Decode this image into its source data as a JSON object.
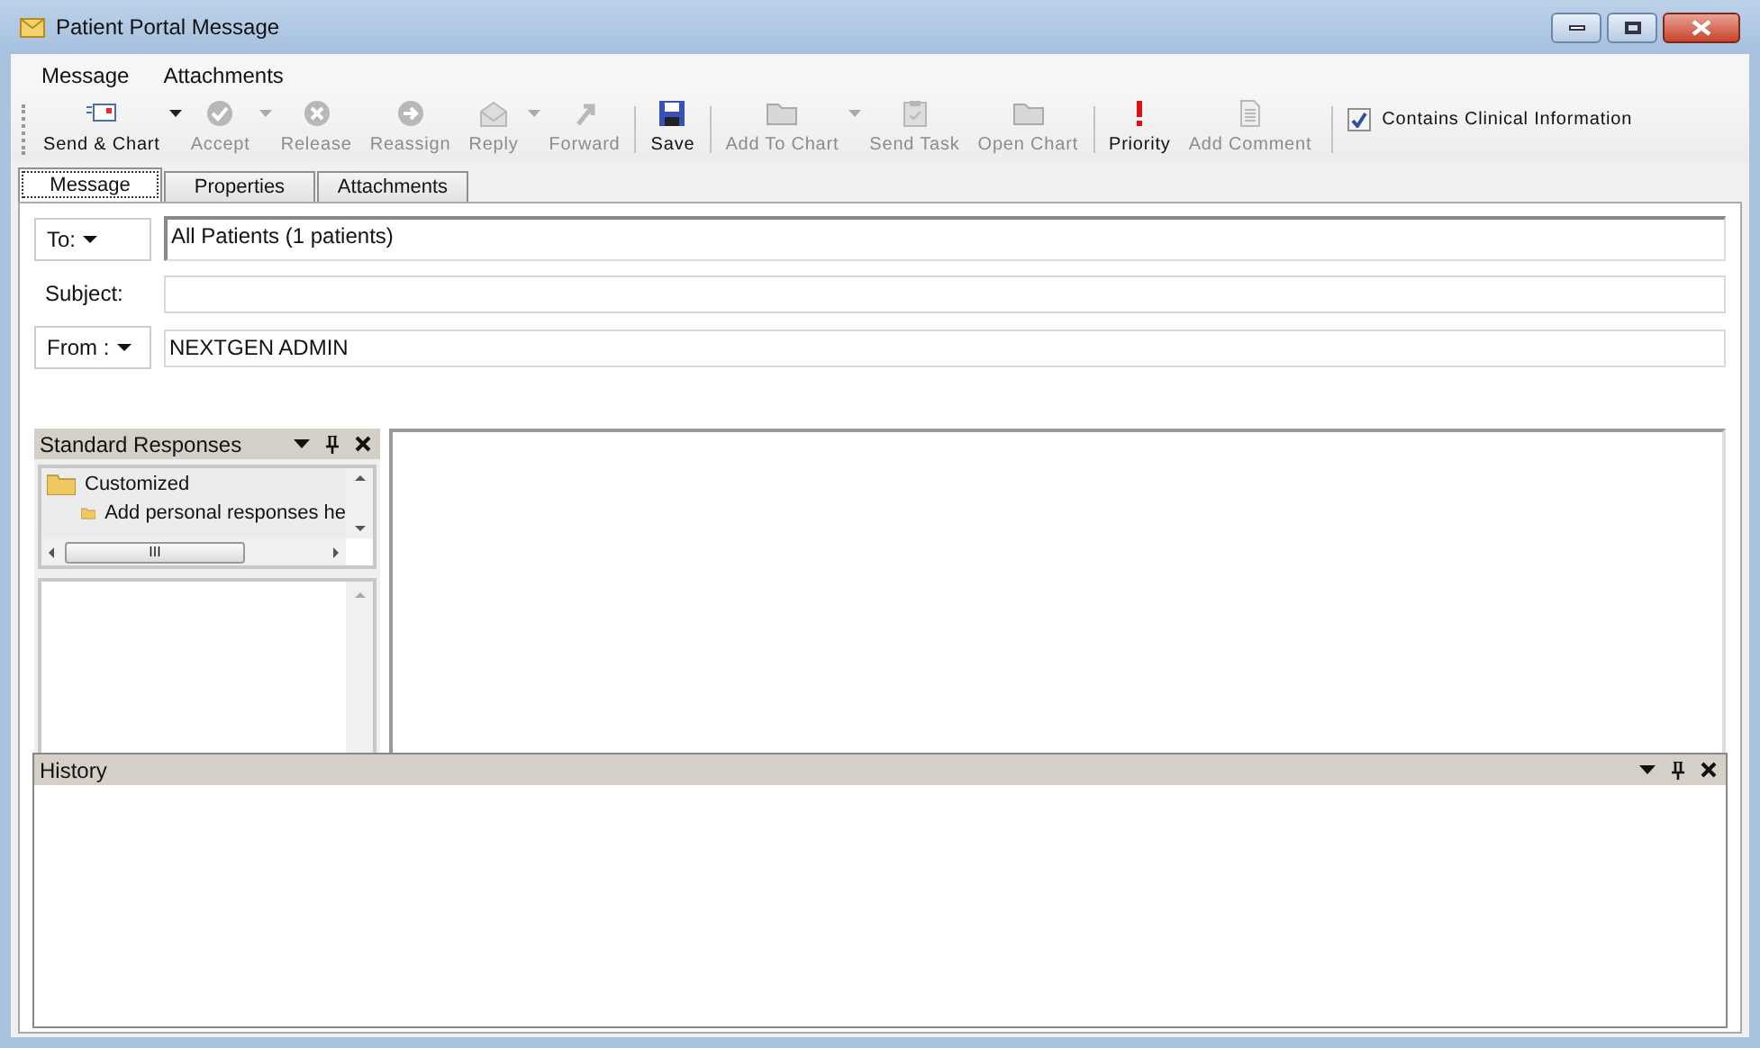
{
  "window": {
    "title": "Patient Portal Message"
  },
  "menu": [
    "Message",
    "Attachments"
  ],
  "toolbar": [
    {
      "label": "Send & Chart",
      "kind": "send",
      "disabled": false,
      "dropdown": true,
      "separator_before": false
    },
    {
      "label": "Accept",
      "kind": "check",
      "disabled": true,
      "dropdown": true,
      "separator_before": false
    },
    {
      "label": "Release",
      "kind": "x",
      "disabled": true,
      "dropdown": false,
      "separator_before": false
    },
    {
      "label": "Reassign",
      "kind": "arrow",
      "disabled": true,
      "dropdown": false,
      "separator_before": false
    },
    {
      "label": "Reply",
      "kind": "reply",
      "disabled": true,
      "dropdown": true,
      "separator_before": false
    },
    {
      "label": "Forward",
      "kind": "forward",
      "disabled": true,
      "dropdown": false,
      "separator_before": false
    },
    {
      "label": "Save",
      "kind": "save",
      "disabled": false,
      "dropdown": false,
      "separator_before": true
    },
    {
      "label": "Add To Chart",
      "kind": "folder",
      "disabled": true,
      "dropdown": true,
      "separator_before": true
    },
    {
      "label": "Send Task",
      "kind": "clipboard",
      "disabled": true,
      "dropdown": false,
      "separator_before": false
    },
    {
      "label": "Open Chart",
      "kind": "folder",
      "disabled": true,
      "dropdown": false,
      "separator_before": false
    },
    {
      "label": "Priority",
      "kind": "priority",
      "disabled": false,
      "dropdown": false,
      "separator_before": true
    },
    {
      "label": "Add Comment",
      "kind": "document",
      "disabled": true,
      "dropdown": false,
      "separator_before": false
    }
  ],
  "clinical_checkbox": {
    "label": "Contains Clinical Information",
    "checked": true
  },
  "tabs": [
    {
      "label": "Message",
      "selected": true
    },
    {
      "label": "Properties",
      "selected": false
    },
    {
      "label": "Attachments",
      "selected": false
    }
  ],
  "fields": [
    {
      "kind": "dropdown",
      "label": "To:",
      "value": "All Patients (1 patients)"
    },
    {
      "kind": "label",
      "label": "Subject:"
    },
    {
      "kind": "dropdown",
      "label": "From :",
      "value": "NEXTGEN ADMIN"
    }
  ],
  "standard_responses": {
    "title": "Standard Responses",
    "tree": [
      {
        "label": "Customized",
        "children": [
          {
            "label": "Add personal responses he"
          }
        ]
      }
    ],
    "scroll_thumb": "III"
  },
  "history": {
    "title": "History"
  }
}
